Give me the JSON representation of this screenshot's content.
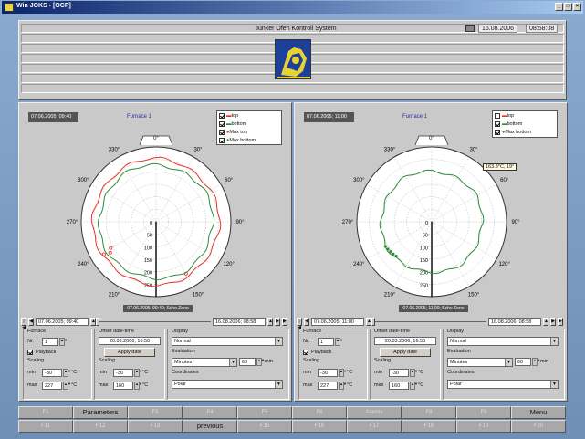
{
  "window": {
    "title": "Win JOKS - [OCP]"
  },
  "header": {
    "title": "Junker Ofen Kontroll System",
    "date": "16.08.2006",
    "time": "08:58:08"
  },
  "panels": [
    {
      "date_label": "07.06.2005; 09:40",
      "furnace_label": "Furnace 1",
      "legend": [
        {
          "label": "top",
          "checked": true,
          "color": "#e8342a",
          "marker": "line"
        },
        {
          "label": "bottom",
          "checked": true,
          "color": "#2e8b3a",
          "marker": "line"
        },
        {
          "label": "Max top",
          "checked": true,
          "color": "#e8342a",
          "marker": "dot"
        },
        {
          "label": "Max bottom",
          "checked": true,
          "color": "#2e8b3a",
          "marker": "dot"
        }
      ],
      "timeline_label": "07.06.2005; 09:40; Scho Zeno",
      "range_start": "07.06.2005; 09:40",
      "range_end": "16.08.2006; 08:58",
      "furnace_nr": "1",
      "playback": true,
      "offset_date": "20.03.2006; 16:50",
      "apply_label": "Apply date",
      "scaling_left": {
        "min": "-30",
        "max": "227"
      },
      "scaling_mid": {
        "min": "-30",
        "max": "160"
      },
      "display": "Normal",
      "evaluation": "Minutes",
      "evaluation_value": "60",
      "coordinates": "Polar",
      "tooltip": ""
    },
    {
      "date_label": "07.06.2005; 11:00",
      "furnace_label": "Furnace 1",
      "legend": [
        {
          "label": "top",
          "checked": false,
          "color": "#e8342a",
          "marker": "line"
        },
        {
          "label": "bottom",
          "checked": true,
          "color": "#2e8b3a",
          "marker": "line"
        },
        {
          "label": "Max bottom",
          "checked": true,
          "color": "#2e8b3a",
          "marker": "dot"
        }
      ],
      "timeline_label": "07.06.2005; 11:00; Scho Zeno",
      "range_start": "07.06.2005; 11:00",
      "range_end": "16.08.2006; 08:58",
      "furnace_nr": "1",
      "playback": true,
      "offset_date": "20.03.2006; 16:50",
      "apply_label": "Apply date",
      "scaling_left": {
        "min": "-30",
        "max": "227"
      },
      "scaling_mid": {
        "min": "-30",
        "max": "160"
      },
      "display": "Normal",
      "evaluation": "Minutes",
      "evaluation_value": "60",
      "coordinates": "Polar",
      "tooltip": "163.3°C, 19°"
    }
  ],
  "labels": {
    "furnace": "Furnace",
    "nr": "Nr.",
    "playback": "Playback",
    "scaling": "Scaling",
    "min": "min",
    "max": "max",
    "unit_c": "°C",
    "offset_group": "Offset date-time",
    "display_group": "Display",
    "evaluation_group": "Evaluation",
    "coordinates_group": "Coordinates",
    "unit_min": "min"
  },
  "polar": {
    "angle_labels": [
      "0°",
      "30°",
      "60°",
      "90°",
      "120°",
      "150°",
      "180°",
      "210°",
      "240°",
      "270°",
      "300°",
      "330°"
    ],
    "radial_labels": [
      "0",
      "50",
      "100",
      "150",
      "200",
      "250"
    ]
  },
  "fkeys_top": [
    "F1",
    "Parameters",
    "F3",
    "F4",
    "F5",
    "F6",
    "Alarms",
    "F8",
    "F9",
    "Menu"
  ],
  "fkeys_bottom": [
    "F11",
    "F12",
    "F13",
    "previous",
    "F15",
    "F16",
    "F17",
    "F18",
    "F19",
    "F20"
  ],
  "fkeys_active": [
    "Parameters",
    "Menu",
    "previous"
  ]
}
